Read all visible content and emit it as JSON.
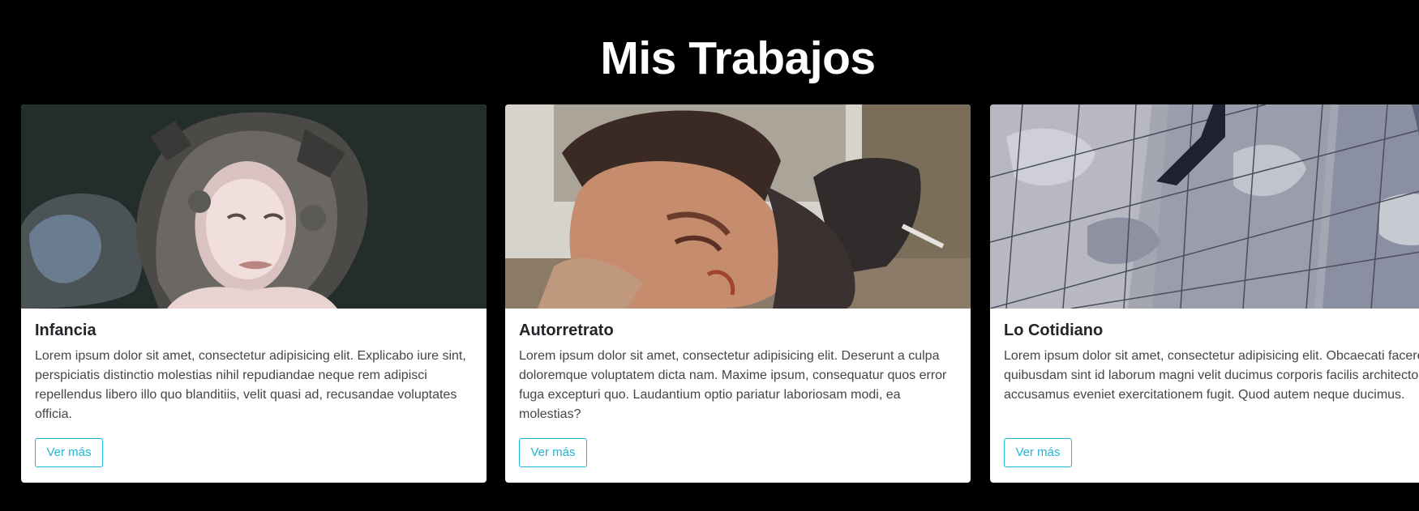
{
  "section": {
    "title": "Mis Trabajos"
  },
  "cards": [
    {
      "title": "Infancia",
      "text": "Lorem ipsum dolor sit amet, consectetur adipisicing elit. Explicabo iure sint, perspiciatis distinctio molestias nihil repudiandae neque rem adipisci repellendus libero illo quo blanditiis, velit quasi ad, recusandae voluptates officia.",
      "button_label": "Ver más"
    },
    {
      "title": "Autorretrato",
      "text": "Lorem ipsum dolor sit amet, consectetur adipisicing elit. Deserunt a culpa doloremque voluptatem dicta nam. Maxime ipsum, consequatur quos error fuga excepturi quo. Laudantium optio pariatur laboriosam modi, ea molestias?",
      "button_label": "Ver más"
    },
    {
      "title": "Lo Cotidiano",
      "text": "Lorem ipsum dolor sit amet, consectetur adipisicing elit. Obcaecati facere quibusdam sint id laborum magni velit ducimus corporis facilis architecto dolor, accusamus eveniet exercitationem fugit. Quod autem neque ducimus.",
      "button_label": "Ver más"
    }
  ],
  "colors": {
    "background": "#000000",
    "card": "#ffffff",
    "accent": "#1fb5d4"
  }
}
